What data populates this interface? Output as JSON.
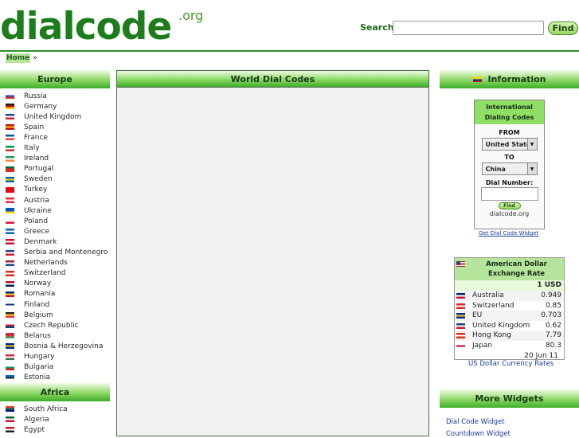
{
  "header": {
    "logo_main": "dialcode",
    "logo_tld": ".org",
    "search_label": "Search",
    "search_value": "",
    "find_label": "Find"
  },
  "breadcrumb": {
    "home": "Home",
    "separator": "»"
  },
  "europe": {
    "title": "Europe",
    "countries": [
      {
        "name": "Russia",
        "flag": [
          "#ffffff",
          "#2244cc",
          "#d52b1e"
        ]
      },
      {
        "name": "Germany",
        "flag": [
          "#222222",
          "#dd0000",
          "#ffce00"
        ]
      },
      {
        "name": "United Kingdom",
        "flag": [
          "#223f8f",
          "#ffffff",
          "#cc1d2c"
        ]
      },
      {
        "name": "Spain",
        "flag": [
          "#c60b1e",
          "#ffc400",
          "#c60b1e"
        ]
      },
      {
        "name": "France",
        "flag": [
          "#0055a4",
          "#ffffff",
          "#ef4135"
        ]
      },
      {
        "name": "Italy",
        "flag": [
          "#009246",
          "#ffffff",
          "#ce2b37"
        ]
      },
      {
        "name": "Ireland",
        "flag": [
          "#169b62",
          "#ffffff",
          "#ff883e"
        ]
      },
      {
        "name": "Portugal",
        "flag": [
          "#046a38",
          "#da291c",
          "#da291c"
        ]
      },
      {
        "name": "Sweden",
        "flag": [
          "#006aa7",
          "#fecc00",
          "#006aa7"
        ]
      },
      {
        "name": "Turkey",
        "flag": [
          "#e30a17",
          "#e30a17",
          "#e30a17"
        ]
      },
      {
        "name": "Austria",
        "flag": [
          "#ed2939",
          "#ffffff",
          "#ed2939"
        ]
      },
      {
        "name": "Ukraine",
        "flag": [
          "#0057b7",
          "#0057b7",
          "#ffd700"
        ]
      },
      {
        "name": "Poland",
        "flag": [
          "#ffffff",
          "#ffffff",
          "#dc143c"
        ]
      },
      {
        "name": "Greece",
        "flag": [
          "#0d5eaf",
          "#ffffff",
          "#0d5eaf"
        ]
      },
      {
        "name": "Denmark",
        "flag": [
          "#c8102e",
          "#ffffff",
          "#c8102e"
        ]
      },
      {
        "name": "Serbia and Montenegro",
        "flag": [
          "#223f8f",
          "#ffffff",
          "#cc1d2c"
        ]
      },
      {
        "name": "Netherlands",
        "flag": [
          "#ae1c28",
          "#ffffff",
          "#21468b"
        ]
      },
      {
        "name": "Switzerland",
        "flag": [
          "#d52b1e",
          "#ffffff",
          "#d52b1e"
        ]
      },
      {
        "name": "Norway",
        "flag": [
          "#ba0c2f",
          "#ffffff",
          "#00205b"
        ]
      },
      {
        "name": "Romania",
        "flag": [
          "#002b7f",
          "#fcd116",
          "#ce1126"
        ]
      },
      {
        "name": "Finland",
        "flag": [
          "#ffffff",
          "#003580",
          "#ffffff"
        ]
      },
      {
        "name": "Belgium",
        "flag": [
          "#222222",
          "#fdda24",
          "#ef3340"
        ]
      },
      {
        "name": "Czech Republic",
        "flag": [
          "#ffffff",
          "#d7141a",
          "#11457e"
        ]
      },
      {
        "name": "Belarus",
        "flag": [
          "#c8313e",
          "#c8313e",
          "#4aa657"
        ]
      },
      {
        "name": "Bosnia & Herzegovina",
        "flag": [
          "#002395",
          "#fecb00",
          "#002395"
        ]
      },
      {
        "name": "Hungary",
        "flag": [
          "#cd2a3e",
          "#ffffff",
          "#436f4d"
        ]
      },
      {
        "name": "Bulgaria",
        "flag": [
          "#ffffff",
          "#00966e",
          "#d62612"
        ]
      },
      {
        "name": "Estonia",
        "flag": [
          "#0072ce",
          "#222222",
          "#ffffff"
        ]
      }
    ]
  },
  "africa": {
    "title": "Africa",
    "countries": [
      {
        "name": "South Africa",
        "flag": [
          "#e03c31",
          "#007749",
          "#001489"
        ]
      },
      {
        "name": "Algeria",
        "flag": [
          "#006233",
          "#ffffff",
          "#d21034"
        ]
      },
      {
        "name": "Egypt",
        "flag": [
          "#ce1126",
          "#ffffff",
          "#222222"
        ]
      }
    ]
  },
  "center": {
    "title": "World Dial Codes"
  },
  "information": {
    "title": "Information",
    "widget": {
      "title": "International Dialing Codes",
      "from_label": "FROM",
      "from_value": "United States",
      "to_label": "TO",
      "to_value": "China",
      "dial_label": "Dial Number:",
      "find_label": "Find",
      "site": "dialcode.org"
    },
    "get_widget": "Get Dial Code Widget"
  },
  "rates": {
    "title": "American Dollar Exchange Rate",
    "base": "1 USD",
    "rows": [
      {
        "currency": "Australia",
        "value": "0.949",
        "flag": [
          "#00247d",
          "#ffffff",
          "#cc142b"
        ]
      },
      {
        "currency": "Switzerland",
        "value": "0.85",
        "flag": [
          "#d52b1e",
          "#ffffff",
          "#d52b1e"
        ]
      },
      {
        "currency": "EU",
        "value": "0.703",
        "flag": [
          "#003399",
          "#ffcc00",
          "#003399"
        ]
      },
      {
        "currency": "United Kingdom",
        "value": "0.62",
        "flag": [
          "#223f8f",
          "#ffffff",
          "#cc1d2c"
        ]
      },
      {
        "currency": "Hong Kong",
        "value": "7.79",
        "flag": [
          "#de2910",
          "#ffffff",
          "#de2910"
        ]
      },
      {
        "currency": "Japan",
        "value": "80.3",
        "flag": [
          "#ffffff",
          "#bc002d",
          "#ffffff"
        ]
      }
    ],
    "date": "20 Jun 11",
    "link": "US Dollar Currency Rates"
  },
  "more_widgets": {
    "title": "More Widgets",
    "items": [
      "Dial Code Widget",
      "Countdown Widget"
    ]
  }
}
